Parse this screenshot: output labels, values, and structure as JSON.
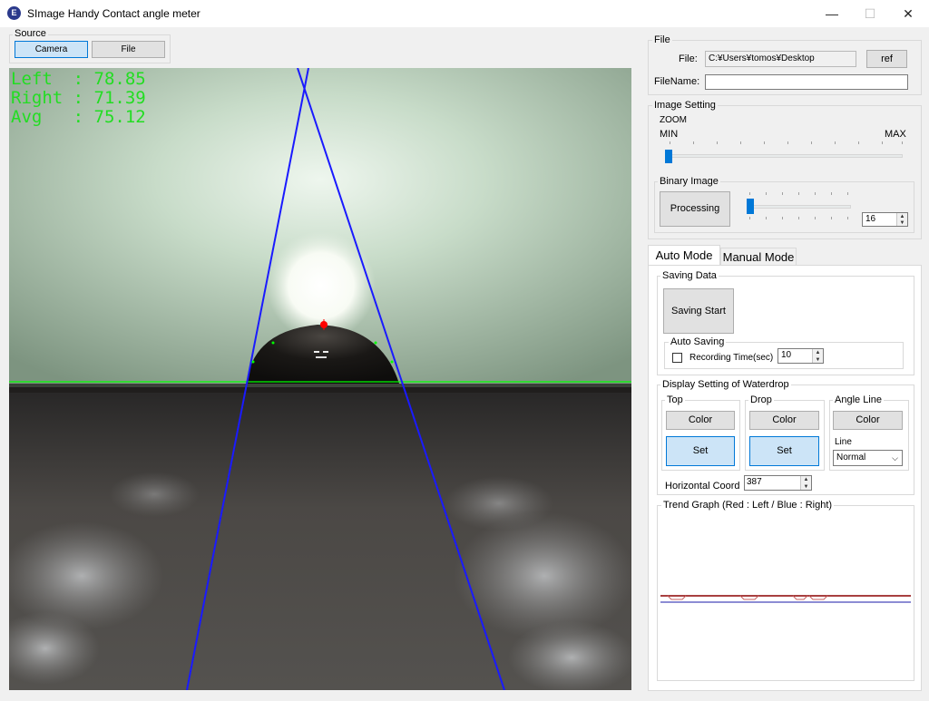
{
  "window": {
    "title": "SImage Handy Contact angle meter",
    "app_icon_glyph": "E",
    "min_glyph": "—",
    "max_glyph": "☐",
    "close_glyph": "✕"
  },
  "source": {
    "label": "Source",
    "camera_label": "Camera",
    "file_label": "File",
    "selected": "Camera"
  },
  "camera_view": {
    "overlay_left": "Left  : 78.85",
    "overlay_right": "Right : 71.39",
    "overlay_avg": "Avg   : 75.12",
    "overlay_color": "#22dd22",
    "line_color": "#1a1aff",
    "baseline_color": "#00ff00",
    "apex_color": "#ff0000"
  },
  "file_group": {
    "label": "File",
    "file_label": "File:",
    "file_path": "C:¥Users¥tomos¥Desktop",
    "ref_label": "ref",
    "filename_label": "FileName:",
    "filename_value": ""
  },
  "image_setting": {
    "label": "Image Setting",
    "zoom_label": "ZOOM",
    "zoom_min": "MIN",
    "zoom_max": "MAX",
    "zoom_level": 0
  },
  "binary_image": {
    "label": "Binary Image",
    "processing_label": "Processing",
    "threshold_value": "16"
  },
  "tabs": {
    "auto_mode": "Auto Mode",
    "manual_mode": "Manual Mode",
    "active": "Auto Mode"
  },
  "saving_data": {
    "label": "Saving Data",
    "saving_start_label": "Saving Start",
    "auto_saving_label": "Auto Saving",
    "recording_time_label": "Recording Time(sec)",
    "recording_time_value": "10",
    "recording_checked": false
  },
  "display_setting": {
    "label": "Display Setting of Waterdrop",
    "top_label": "Top",
    "drop_label": "Drop",
    "angle_line_label": "Angle Line",
    "color_label": "Color",
    "set_label": "Set",
    "line_label": "Line",
    "line_value": "Normal",
    "horizontal_coord_label": "Horizontal Coord",
    "horizontal_coord_value": "387"
  },
  "trend_graph": {
    "label": "Trend Graph (Red : Left / Blue : Right)",
    "left_color": "#8b0000",
    "right_color": "#1a1aaa"
  }
}
